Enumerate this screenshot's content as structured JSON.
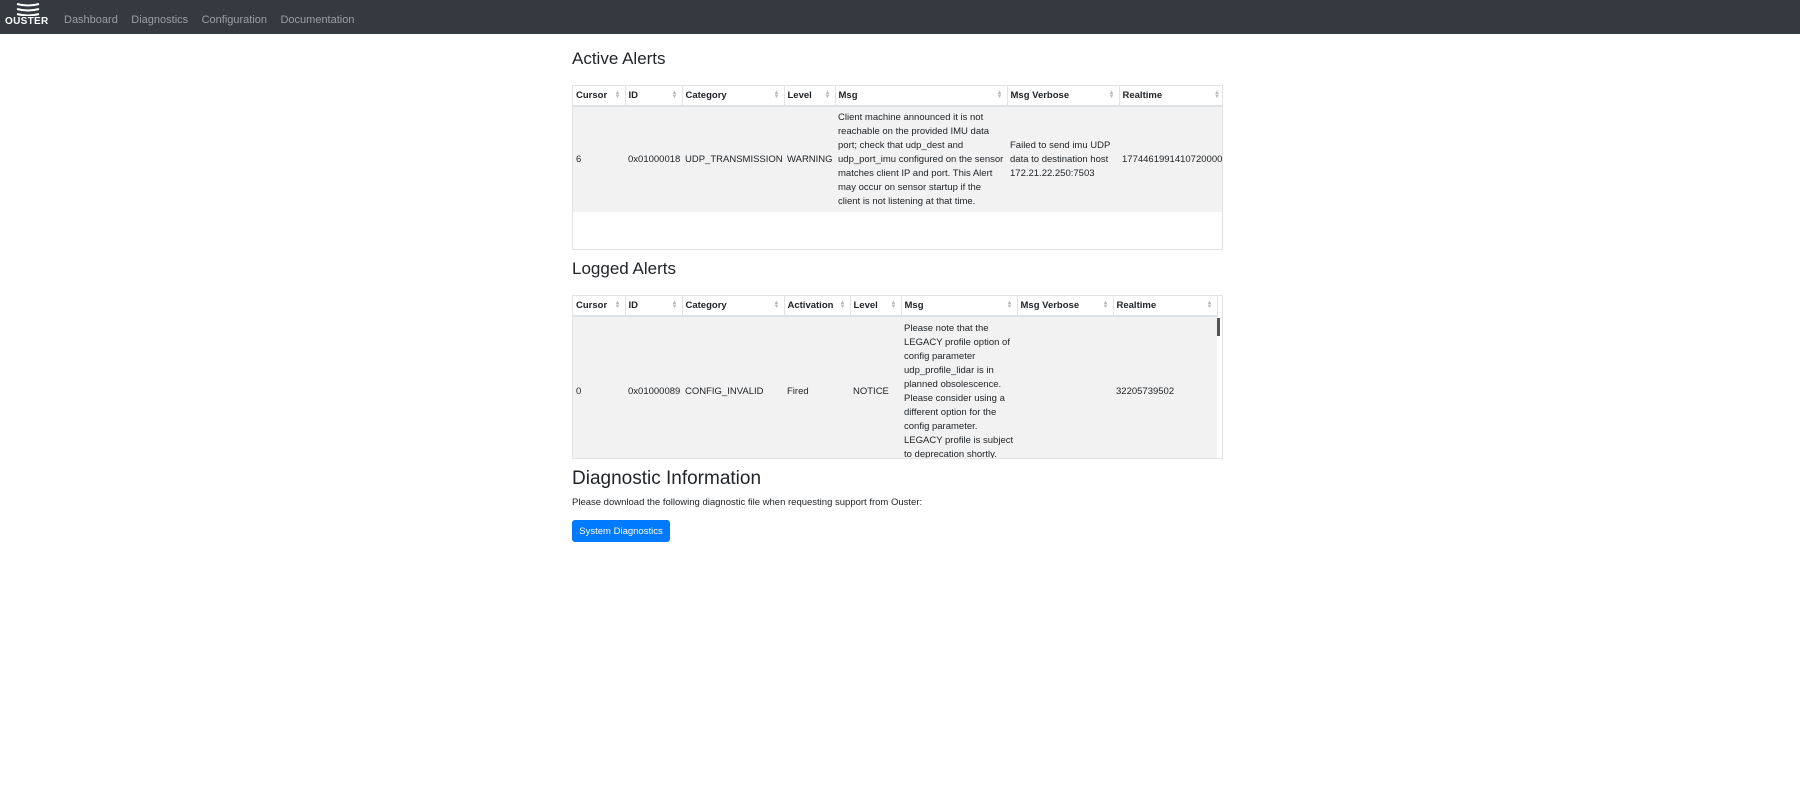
{
  "brand": {
    "logo_text": "OUSTER"
  },
  "nav": {
    "items": [
      "Dashboard",
      "Diagnostics",
      "Configuration",
      "Documentation"
    ]
  },
  "active_alerts": {
    "title": "Active Alerts",
    "columns": [
      "Cursor",
      "ID",
      "Category",
      "Level",
      "Msg",
      "Msg Verbose",
      "Realtime"
    ],
    "rows": [
      {
        "cursor": "6",
        "id": "0x01000018",
        "category": "UDP_TRANSMISSION",
        "level": "WARNING",
        "msg": "Client machine announced it is not reachable on the provided IMU data port; check that udp_dest and udp_port_imu configured on the sensor matches client IP and port. This Alert may occur on sensor startup if the client is not listening at that time.",
        "msg_verbose": "Failed to send imu UDP data to destination host 172.21.22.250:7503",
        "realtime": "1774461991410720000"
      }
    ]
  },
  "logged_alerts": {
    "title": "Logged Alerts",
    "columns": [
      "Cursor",
      "ID",
      "Category",
      "Activation",
      "Level",
      "Msg",
      "Msg Verbose",
      "Realtime"
    ],
    "rows": [
      {
        "cursor": "0",
        "id": "0x01000089",
        "category": "CONFIG_INVALID",
        "activation": "Fired",
        "level": "NOTICE",
        "msg": "Please note that the LEGACY profile option of config parameter udp_profile_lidar is in planned obsolescence. Please consider using a different option for the config parameter. LEGACY profile is subject to deprecation shortly.",
        "msg_verbose": "",
        "realtime": "32205739502"
      }
    ]
  },
  "diagnostics": {
    "title": "Diagnostic Information",
    "text": "Please download the following diagnostic file when requesting support from Ouster:",
    "button_label": "System Diagnostics"
  },
  "colors": {
    "navbar": "#343a40",
    "primary": "#007bff",
    "row_bg": "#f2f2f2"
  }
}
